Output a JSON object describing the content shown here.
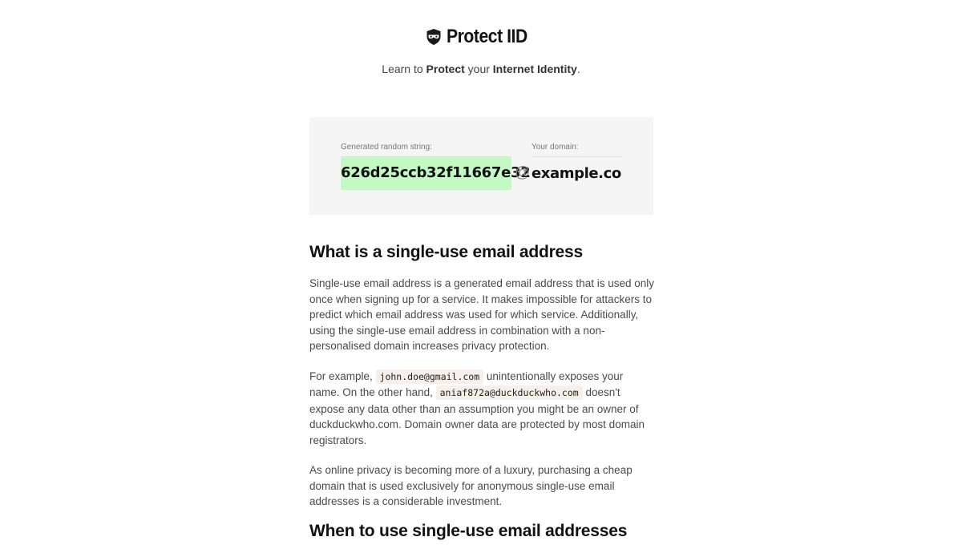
{
  "header": {
    "brand": "Protect IID",
    "tagline_parts": [
      "Learn to ",
      "Protect",
      " your ",
      "Internet Identity",
      "."
    ]
  },
  "generator": {
    "random_label": "Generated random string:",
    "random_value": "626d25ccb32f11667e32",
    "at_symbol": "@",
    "domain_label": "Your domain:",
    "domain_value": "example.com",
    "highlight_color": "#c3f9c3"
  },
  "article": {
    "heading1": "What is a single-use email address",
    "p1": "Single-use email address is a generated email address that is used only once when signing up for a service. It makes impossible for attackers to predict which email address was used for which service. Additionally, using the single-use email address in combination with a non-personalised domain increases privacy protection.",
    "p2_a": "For example, ",
    "p2_code1": "john.doe@gmail.com",
    "p2_b": " unintentionally exposes your name. On the other hand, ",
    "p2_code2": "aniaf872a@duckduckwho.com",
    "p2_c": " doesn't expose any data other than an assumption you might be an owner of duckduckwho.com. Domain owner data are protected by most domain registrators.",
    "p3": "As online privacy is becoming more of a luxury, purchasing a cheap domain that is used exclusively for anonymous single-use email addresses is a considerable investment.",
    "heading2": "When to use single-use email addresses"
  }
}
